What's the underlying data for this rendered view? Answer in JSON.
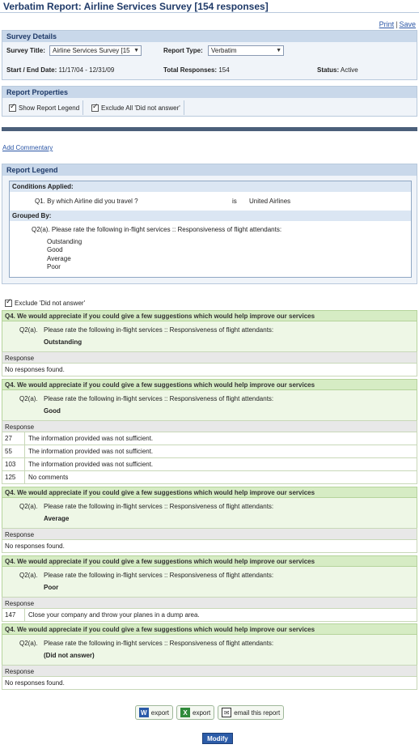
{
  "page": {
    "title": "Verbatim Report: Airline Services Survey [154 responses]",
    "print_link": "Print",
    "link_separator": "|",
    "save_link": "Save"
  },
  "survey_details": {
    "header": "Survey Details",
    "survey_title_label": "Survey Title:",
    "survey_title_value": "Airline Services Survey [15",
    "report_type_label": "Report Type:",
    "report_type_value": "Verbatim",
    "date_label": "Start / End Date:",
    "date_value": "11/17/04 - 12/31/09",
    "total_label": "Total Responses:",
    "total_value": "154",
    "status_label": "Status:",
    "status_value": "Active"
  },
  "report_properties": {
    "header": "Report Properties",
    "show_legend": "Show Report Legend",
    "exclude_all": "Exclude All 'Did not answer'"
  },
  "add_commentary": "Add Commentary",
  "report_legend": {
    "header": "Report Legend",
    "conditions_header": "Conditions Applied:",
    "condition_question": "Q1. By which Airline did you travel ?",
    "condition_operator": "is",
    "condition_value": "United Airlines",
    "grouped_header": "Grouped By:",
    "grouped_question": "Q2(a). Please rate the following in-flight services :: Responsiveness of flight attendants:",
    "groups": [
      "Outstanding",
      "Good",
      "Average",
      "Poor"
    ]
  },
  "exclude_did_not_answer": "Exclude 'Did not answer'",
  "results": [
    {
      "question": "Q4. We would appreciate if you could give a few suggestions which would help improve our services",
      "group_qnum": "Q2(a).",
      "group_qtext": "Please rate the following in-flight services :: Responsiveness of flight attendants:",
      "group_value": "Outstanding",
      "response_header": "Response",
      "rows": [],
      "no_responses": "No responses found."
    },
    {
      "question": "Q4. We would appreciate if you could give a few suggestions which would help improve our services",
      "group_qnum": "Q2(a).",
      "group_qtext": "Please rate the following in-flight services :: Responsiveness of flight attendants:",
      "group_value": "Good",
      "response_header": "Response",
      "rows": [
        {
          "id": "27",
          "text": "The information provided was not sufficient."
        },
        {
          "id": "55",
          "text": "The information provided was not sufficient."
        },
        {
          "id": "103",
          "text": "The information provided was not sufficient."
        },
        {
          "id": "125",
          "text": "No comments"
        }
      ],
      "no_responses": ""
    },
    {
      "question": "Q4. We would appreciate if you could give a few suggestions which would help improve our services",
      "group_qnum": "Q2(a).",
      "group_qtext": "Please rate the following in-flight services :: Responsiveness of flight attendants:",
      "group_value": "Average",
      "response_header": "Response",
      "rows": [],
      "no_responses": "No responses found."
    },
    {
      "question": "Q4. We would appreciate if you could give a few suggestions which would help improve our services",
      "group_qnum": "Q2(a).",
      "group_qtext": "Please rate the following in-flight services :: Responsiveness of flight attendants:",
      "group_value": "Poor",
      "response_header": "Response",
      "rows": [
        {
          "id": "147",
          "text": "Close your company and throw your planes in a dump area."
        }
      ],
      "no_responses": ""
    },
    {
      "question": "Q4. We would appreciate if you could give a few suggestions which would help improve our services",
      "group_qnum": "Q2(a).",
      "group_qtext": "Please rate the following in-flight services :: Responsiveness of flight attendants:",
      "group_value": "(Did not answer)",
      "response_header": "Response",
      "rows": [],
      "no_responses": "No responses found."
    }
  ],
  "export": {
    "word_label": "export",
    "excel_label": "export",
    "email_label": "email this report",
    "word_icon": "word-icon",
    "excel_icon": "excel-icon",
    "email_icon": "envelope-icon"
  },
  "modify_button": "Modify"
}
